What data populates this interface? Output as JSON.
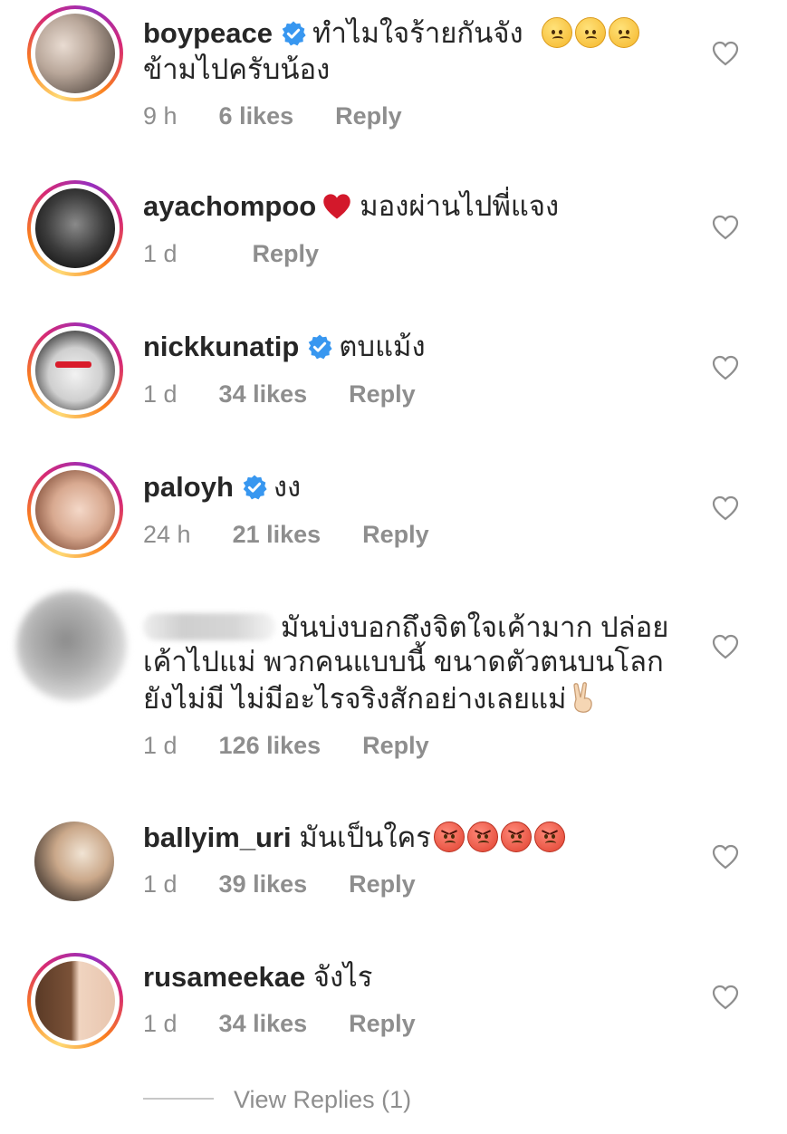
{
  "comments": [
    {
      "username": "boypeace",
      "verified": true,
      "text_line1": "ทำไมใจร้ายกันจัง",
      "text_line2": "ข้ามไปครับน้อง",
      "emojis": [
        "worried-face",
        "worried-face",
        "worried-face"
      ],
      "time": "9 h",
      "likes": "6 likes",
      "reply": "Reply"
    },
    {
      "username": "ayachompoo",
      "verified": false,
      "emoji": "red-heart",
      "text_line1": "มองผ่านไปพี่แจง",
      "time": "1 d",
      "reply": "Reply"
    },
    {
      "username": "nickkunatip",
      "verified": true,
      "text_line1": "ตบแม้ง",
      "time": "1 d",
      "likes": "34 likes",
      "reply": "Reply"
    },
    {
      "username": "paloyh",
      "verified": true,
      "text_line1": "งง",
      "time": "24 h",
      "likes": "21 likes",
      "reply": "Reply"
    },
    {
      "username_blurred": true,
      "text_line1": "มันบ่งบอกถึงจิตใจเค้ามาก ปล่อย",
      "text_line2": "เค้าไปแม่ พวกคนแบบนี้ ขนาดตัวตนบนโลก",
      "text_line3": "ยังไม่มี ไม่มีอะไรจริงสักอย่างเลยแม่",
      "emoji": "victory-hand",
      "time": "1 d",
      "likes": "126 likes",
      "reply": "Reply"
    },
    {
      "username": "ballyim_uri",
      "verified": false,
      "text_line1": "มันเป็นใคร",
      "emojis": [
        "angry-face",
        "angry-face",
        "angry-face",
        "angry-face"
      ],
      "time": "1 d",
      "likes": "39 likes",
      "reply": "Reply"
    },
    {
      "username": "rusameekae",
      "verified": false,
      "text_line1": "จังไร",
      "time": "1 d",
      "likes": "34 likes",
      "reply": "Reply"
    }
  ],
  "view_replies": "View Replies (1)",
  "colors": {
    "text": "#262626",
    "meta": "#8e8e8e",
    "verified": "#3897f0",
    "heart_outline": "#8e8e8e"
  }
}
